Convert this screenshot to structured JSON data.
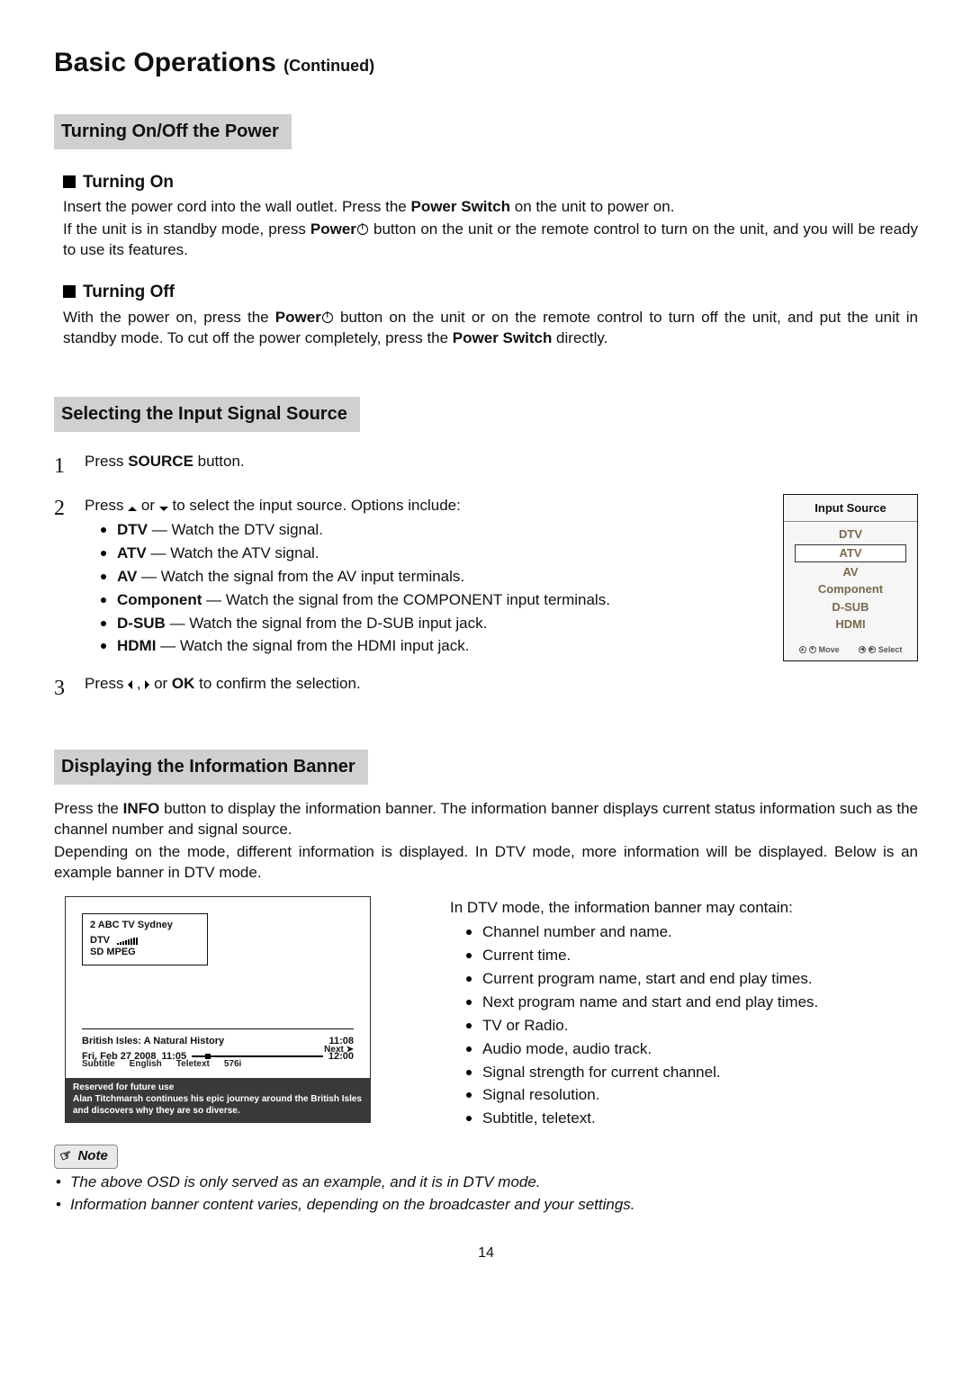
{
  "page_number": "14",
  "title": {
    "main": "Basic Operations",
    "cont": "(Continued)"
  },
  "power": {
    "heading": "Turning On/Off the Power",
    "on_h": "Turning On",
    "on_p1a": "Insert the power cord into the wall outlet. Press the ",
    "on_p1b": "Power Switch",
    "on_p1c": " on the unit to power on.",
    "on_p2a": "If the unit is in standby mode, press ",
    "on_p2b": "Power",
    "on_p2c": " button on the unit or the remote control to turn on the unit, and you will be ready to use its features.",
    "off_h": "Turning Off",
    "off_p1a": "With the power on, press the ",
    "off_p1b": "Power",
    "off_p1c": " button on the unit or on the remote control to turn off the unit, and put the unit in standby mode. To cut off the power completely, press the ",
    "off_p1d": "Power Switch",
    "off_p1e": " directly."
  },
  "source": {
    "heading": "Selecting the Input Signal Source",
    "step1a": "Press ",
    "step1b": "SOURCE",
    "step1c": " button.",
    "step2_lead": "Press ",
    "step2_or": " or ",
    "step2_tail": " to select the input source. Options include:",
    "options": [
      {
        "name": "DTV",
        "desc": " — Watch the DTV signal."
      },
      {
        "name": "ATV",
        "desc": " — Watch the ATV signal."
      },
      {
        "name": "AV",
        "desc": " — Watch the signal from the AV input terminals."
      },
      {
        "name": "Component",
        "desc": " — Watch the signal from the COMPONENT input terminals."
      },
      {
        "name": "D-SUB",
        "desc": " — Watch the signal from the D-SUB input jack."
      },
      {
        "name": "HDMI",
        "desc": " — Watch the signal from the HDMI input jack."
      }
    ],
    "step3a": "Press ",
    "step3_comma": " , ",
    "step3_or": " or ",
    "step3b": "OK",
    "step3c": " to confirm the selection.",
    "osd": {
      "title": "Input Source",
      "items": [
        "DTV",
        "ATV",
        "AV",
        "Component",
        "D-SUB",
        "HDMI"
      ],
      "selected_index": 1,
      "foot_move": "Move",
      "foot_select": "Select"
    }
  },
  "info": {
    "heading": "Displaying the Information Banner",
    "p1a": "Press the ",
    "p1b": "INFO",
    "p1c": " button to display the information banner. The information banner displays current status information such as the channel number and signal source.",
    "p2": "Depending on the mode, different information is displayed. In DTV mode, more information will be displayed. Below is an example banner in DTV mode.",
    "right_lead": "In DTV mode, the information banner may contain:",
    "right_items": [
      "Channel number and name.",
      "Current time.",
      "Current program name, start and end play times.",
      "Next program name and start and end play times.",
      "TV or Radio.",
      "Audio mode, audio track.",
      "Signal strength for current channel.",
      "Signal resolution.",
      "Subtitle, teletext."
    ],
    "banner": {
      "channel": "2  ABC TV Sydney",
      "mode": "DTV",
      "codec": "SD  MPEG",
      "prog": "British Isles: A Natural History",
      "now": "11:08",
      "date": "Fri, Feb 27 2008",
      "start": "11:05",
      "end": "12:00",
      "tags": [
        "Subtitle",
        "English",
        "Teletext",
        "576i"
      ],
      "next": "Next ➤",
      "desc1": "Reserved for future use",
      "desc2": "Alan Titchmarsh continues his epic journey around the British Isles and discovers why they are so diverse."
    }
  },
  "note": {
    "label": "Note",
    "items": [
      "The above OSD is only served as an example, and it is in DTV mode.",
      "Information banner content varies, depending on the broadcaster and your settings."
    ]
  }
}
